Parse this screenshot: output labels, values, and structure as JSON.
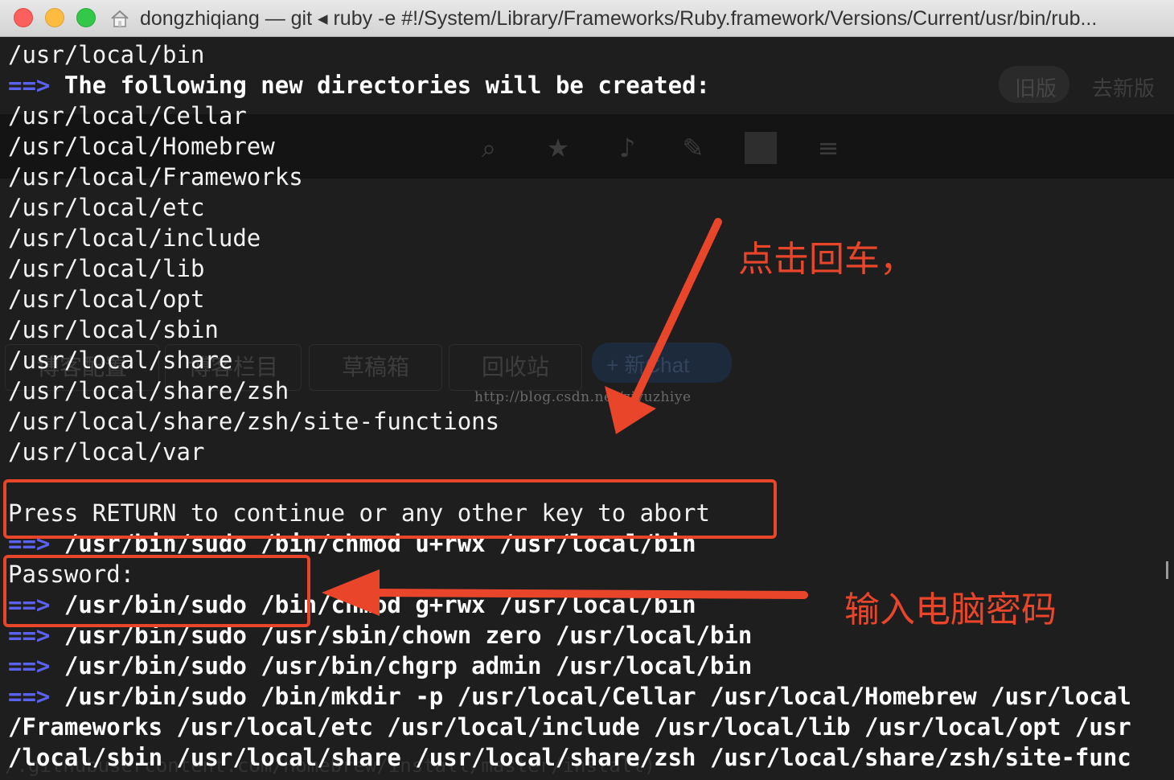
{
  "window": {
    "title": "dongzhiqiang — git ◂ ruby -e #!/System/Library/Frameworks/Ruby.framework/Versions/Current/usr/bin/rub..."
  },
  "background_page": {
    "button_old": "旧版",
    "button_new": "去新版",
    "tabs": [
      "博客配置",
      "博客栏目",
      "草稿箱",
      "回收站"
    ],
    "chat_button": "+ 新Chat",
    "footer_url": "/.githubusercontent.com/Homebrew/install/master/install)"
  },
  "watermark": "http://blog.csdn.net/ziyuzhiye",
  "terminal": {
    "prompt_arrow": "==>",
    "lines": [
      "/usr/local/bin",
      "The following new directories will be created:",
      "/usr/local/Cellar",
      "/usr/local/Homebrew",
      "/usr/local/Frameworks",
      "/usr/local/etc",
      "/usr/local/include",
      "/usr/local/lib",
      "/usr/local/opt",
      "/usr/local/sbin",
      "/usr/local/share",
      "/usr/local/share/zsh",
      "/usr/local/share/zsh/site-functions",
      "/usr/local/var",
      "",
      "Press RETURN to continue or any other key to abort",
      "/usr/bin/sudo /bin/chmod u+rwx /usr/local/bin",
      "Password:",
      "/usr/bin/sudo /bin/chmod g+rwx /usr/local/bin",
      "/usr/bin/sudo /usr/sbin/chown zero /usr/local/bin",
      "/usr/bin/sudo /usr/bin/chgrp admin /usr/local/bin",
      "/usr/bin/sudo /bin/mkdir -p /usr/local/Cellar /usr/local/Homebrew /usr/local",
      "/Frameworks /usr/local/etc /usr/local/include /usr/local/lib /usr/local/opt /usr",
      "/local/sbin /usr/local/share /usr/local/share/zsh /usr/local/share/zsh/site-func"
    ]
  },
  "annotations": {
    "press_return_note": "点击回车，",
    "password_note": "输入电脑密码",
    "color": "#e8452b"
  }
}
